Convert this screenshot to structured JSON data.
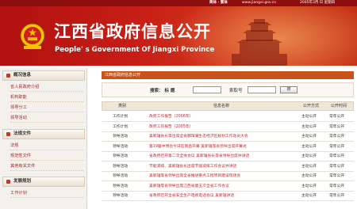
{
  "topbar": {
    "links": "简体 · 繁体",
    "site": "www.jiangxi.gov.cn",
    "date": "2005年3月 日 星期四"
  },
  "header": {
    "title_cn": "江西省政府信息公开",
    "title_en": "People' s Government Of Jiangxi Province"
  },
  "sidebar": {
    "sections": [
      {
        "title": "概况信息",
        "items": [
          "省人民政府介绍",
          "机构职能",
          "领导分工",
          "领导活动"
        ]
      },
      {
        "title": "法规文件",
        "items": [
          "法规",
          "规范性文件",
          "其他有关文件"
        ]
      },
      {
        "title": "发展规划",
        "items": [
          "工作计划"
        ]
      }
    ]
  },
  "main": {
    "panel_title": "江西省政府信息公开",
    "search": {
      "label1": "搜索： 标 题",
      "label2": "索取号",
      "button": "搜"
    },
    "columns": [
      "类别",
      "信息名称",
      "公开方式",
      "公开时间"
    ],
    "rows": [
      {
        "category": "工作计划",
        "name": "政府工作报告（2006年）",
        "mode": "主动公开",
        "time": "常年公开"
      },
      {
        "category": "工作计划",
        "name": "政府工作报告（2005年）",
        "mode": "主动公开",
        "time": "常年公开"
      },
      {
        "category": "领导活动",
        "name": "吴新雄省长等出席全省鄱阳湖生态经济区规划工作动员大会",
        "mode": "主动公开",
        "time": "常年公开"
      },
      {
        "category": "领导活动",
        "name": "第19届中博会今日在南昌开幕 吴新雄等省领导出席开幕式",
        "mode": "主动公开",
        "time": "常年公开"
      },
      {
        "category": "领导活动",
        "name": "省政府召开第二次全体会议 吴新雄省长等省领导出席并讲话",
        "mode": "主动公开",
        "time": "常年公开"
      },
      {
        "category": "领导活动",
        "name": "节能减排、吴新雄省长出席节能减排工作会议并讲话",
        "mode": "主动公开",
        "time": "常年公开"
      },
      {
        "category": "领导活动",
        "name": "吴新雄等省领导出席全省推进重点工程项目建设现场会",
        "mode": "主动公开",
        "time": "常年公开"
      },
      {
        "category": "领导活动",
        "name": "吴新雄等省领导出席江西省第五次全省工作会议",
        "mode": "主动公开",
        "time": "常年公开"
      },
      {
        "category": "领导活动",
        "name": "省政府召开全省安全生产电视电话会议 吴新雄讲话",
        "mode": "主动公开",
        "time": "常年公开"
      }
    ]
  }
}
